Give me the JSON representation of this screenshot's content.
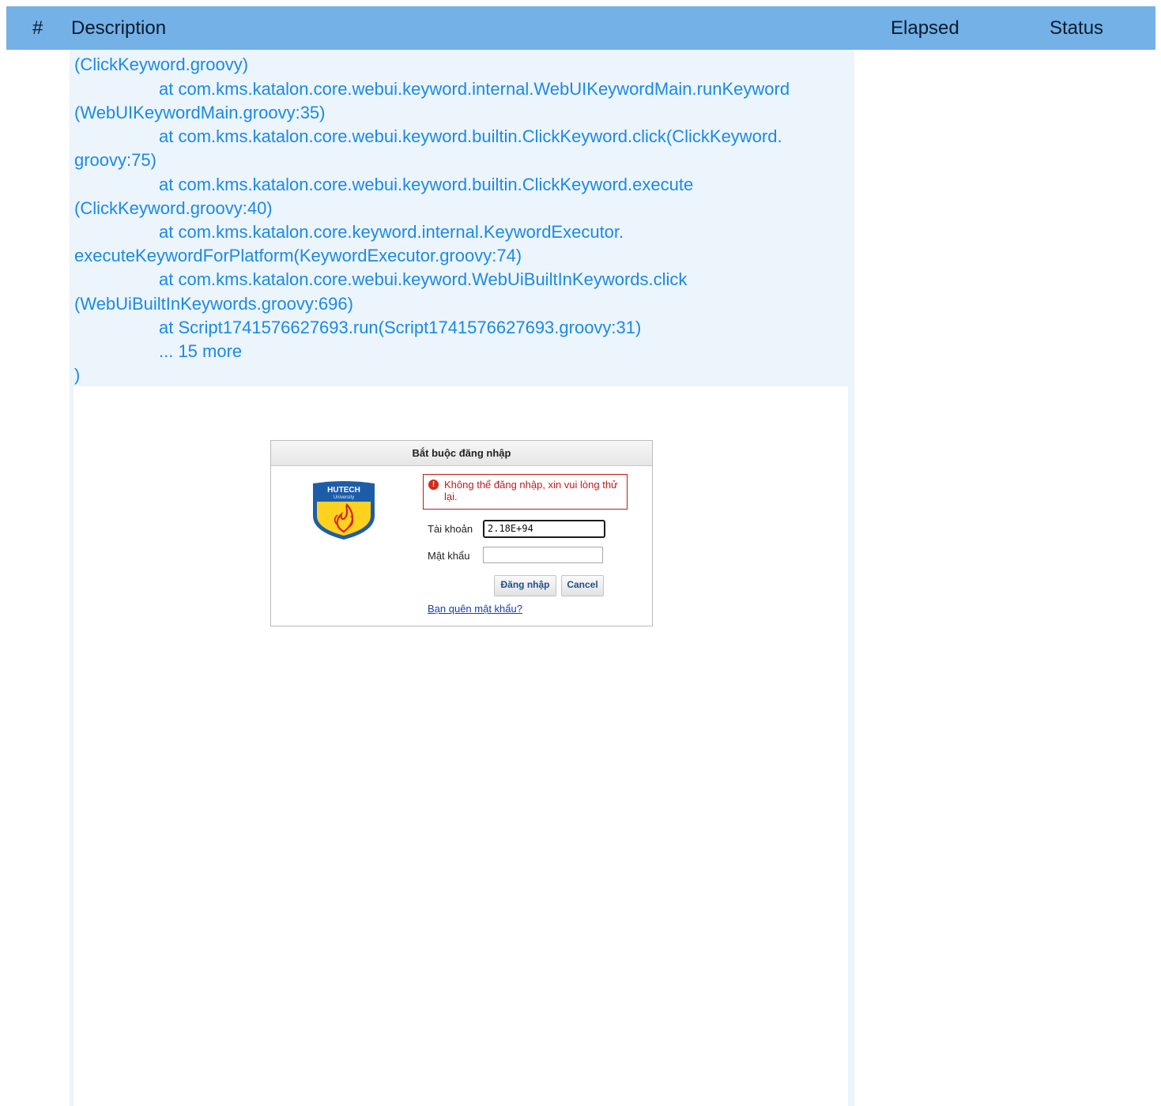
{
  "table": {
    "headers": {
      "num": "#",
      "description": "Description",
      "elapsed": "Elapsed",
      "status": "Status"
    }
  },
  "log": {
    "lines": [
      "(ClickKeyword.groovy)",
      "at com.kms.katalon.core.webui.keyword.internal.WebUIKeywordMain.runKeyword",
      "(WebUIKeywordMain.groovy:35)",
      "at com.kms.katalon.core.webui.keyword.builtin.ClickKeyword.click(ClickKeyword.",
      "groovy:75)",
      "at com.kms.katalon.core.webui.keyword.builtin.ClickKeyword.execute",
      "(ClickKeyword.groovy:40)",
      "at com.kms.katalon.core.keyword.internal.KeywordExecutor.",
      "executeKeywordForPlatform(KeywordExecutor.groovy:74)",
      "at com.kms.katalon.core.webui.keyword.WebUiBuiltInKeywords.click",
      "(WebUiBuiltInKeywords.groovy:696)",
      "at Script1741576627693.run(Script1741576627693.groovy:31)",
      "... 15 more",
      ")"
    ]
  },
  "login": {
    "title": "Bắt buộc đăng nhập",
    "logo_text": "HUTECH",
    "logo_subtext": "University",
    "error": "Không thể đăng nhập, xin vui lòng thử lại.",
    "username_label": "Tài khoản",
    "username_value": "2.18E+94",
    "password_label": "Mật khẩu",
    "password_value": "",
    "login_button": "Đăng nhập",
    "cancel_button": "Cancel",
    "forgot_link": "Bạn quên mật khẩu?",
    "colors": {
      "error": "#c21a1a",
      "link": "#1540b0",
      "logo_blue": "#1d5da8",
      "logo_yellow": "#ffd21f"
    }
  },
  "colors": {
    "header_bg": "#74b1e7",
    "log_text": "#1a8ae6",
    "log_bg": "#ecf4fc"
  }
}
